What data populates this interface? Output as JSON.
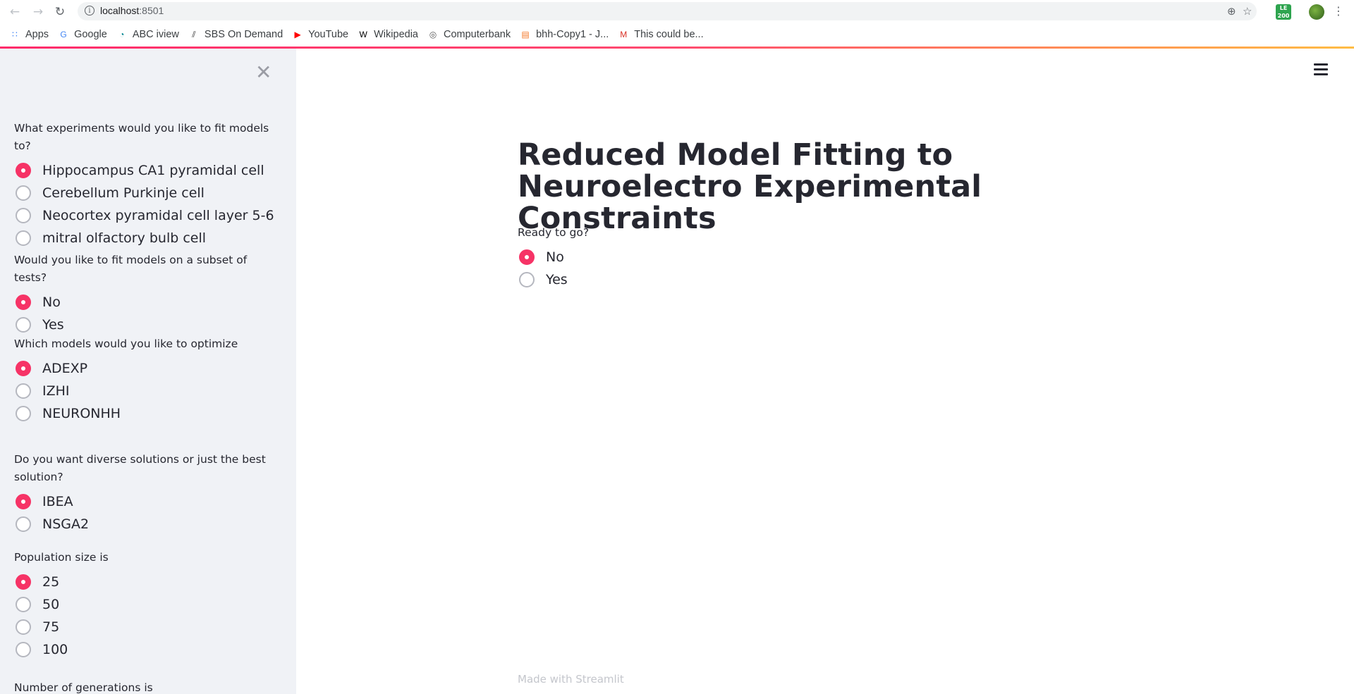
{
  "browser": {
    "url_host": "localhost",
    "url_port": ":8501",
    "bookmarks": [
      {
        "label": "Apps",
        "icon": "apps-grid-icon"
      },
      {
        "label": "Google",
        "icon": "google-icon"
      },
      {
        "label": "ABC iview",
        "icon": "abc-iview-icon"
      },
      {
        "label": "SBS On Demand",
        "icon": "sbs-icon"
      },
      {
        "label": "YouTube",
        "icon": "youtube-icon"
      },
      {
        "label": "Wikipedia",
        "icon": "wikipedia-icon"
      },
      {
        "label": "Computerbank",
        "icon": "globe-icon"
      },
      {
        "label": "bhh-Copy1 - J...",
        "icon": "jupyter-icon"
      },
      {
        "label": "This could be...",
        "icon": "gmail-icon"
      }
    ],
    "extension_badge": "200"
  },
  "sidebar": {
    "groups": [
      {
        "label": "What experiments would you like to fit models to?",
        "options": [
          "Hippocampus CA1 pyramidal cell",
          "Cerebellum Purkinje cell",
          "Neocortex pyramidal cell layer 5-6",
          "mitral olfactory bulb cell"
        ],
        "selected": 0
      },
      {
        "label": "Would you like to fit models on a subset of tests?",
        "options": [
          "No",
          "Yes"
        ],
        "selected": 0
      },
      {
        "label": "Which models would you like to optimize",
        "options": [
          "ADEXP",
          "IZHI",
          "NEURONHH"
        ],
        "selected": 0
      },
      {
        "label": "Do you want diverse solutions or just the best solution?",
        "options": [
          "IBEA",
          "NSGA2"
        ],
        "selected": 0
      },
      {
        "label": "Population size is",
        "options": [
          "25",
          "50",
          "75",
          "100"
        ],
        "selected": 0
      },
      {
        "label": "Number of generations is",
        "options": [],
        "selected": null
      }
    ]
  },
  "main": {
    "title": "Reduced Model Fitting to Neuroelectro Experimental Constraints",
    "ready": {
      "label": "Ready to go?",
      "options": [
        "No",
        "Yes"
      ],
      "selected": 0
    },
    "footer": "Made with Streamlit"
  },
  "colors": {
    "accent": "#f63366",
    "sidebar_bg": "#f0f2f6",
    "text": "#262730"
  }
}
